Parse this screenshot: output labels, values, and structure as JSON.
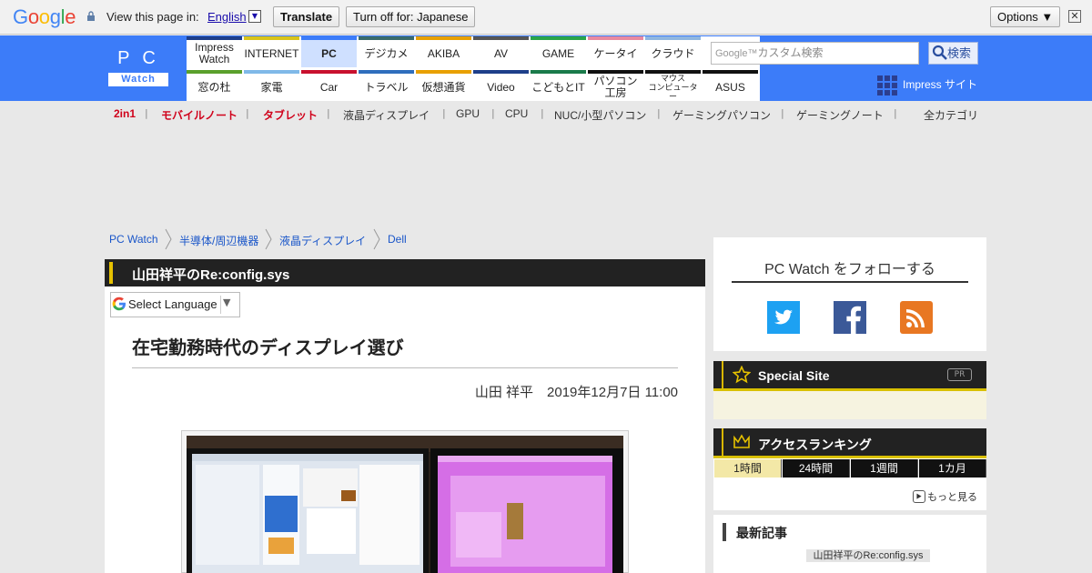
{
  "translate_bar": {
    "logo": "Google",
    "view_text": "View this page in:",
    "language": "English",
    "translate_label": "Translate",
    "turn_off_label": "Turn off for: Japanese",
    "options_label": "Options ▼",
    "close_label": "✕"
  },
  "header": {
    "logo_top": "PC",
    "logo_bottom": "Watch",
    "nav_row1": [
      {
        "label": "Impress\nWatch",
        "color": "#1e3f8a"
      },
      {
        "label": "INTERNET",
        "color": "#d9c41a"
      },
      {
        "label": "PC",
        "color": "#3c7cf9"
      },
      {
        "label": "デジカメ",
        "color": "#3a6b6b"
      },
      {
        "label": "AKIBA",
        "color": "#e8a000"
      },
      {
        "label": "AV",
        "color": "#555555"
      },
      {
        "label": "GAME",
        "color": "#2aa54a"
      },
      {
        "label": "ケータイ",
        "color": "#e88aa0"
      },
      {
        "label": "クラウド",
        "color": "#8fb6e0"
      }
    ],
    "nav_row2": [
      {
        "label": "窓の杜",
        "color": "#5aa02c"
      },
      {
        "label": "家電",
        "color": "#7fb9e8"
      },
      {
        "label": "Car",
        "color": "#c8102e"
      },
      {
        "label": "トラベル",
        "color": "#2f6ebd"
      },
      {
        "label": "仮想通貨",
        "color": "#e8a000"
      },
      {
        "label": "Video",
        "color": "#1e3f8a"
      },
      {
        "label": "こどもとIT",
        "color": "#1a7a4a"
      },
      {
        "label": "パソコン\n工房",
        "color": "#111111"
      },
      {
        "label": "マウス\nコンピューター",
        "color": "#111111"
      },
      {
        "label": "ASUS",
        "color": "#111111"
      }
    ],
    "search_brand": "Google™",
    "search_placeholder": "カスタム検索",
    "search_button": "検索",
    "impress_site": "Impress サイト"
  },
  "subnav": [
    {
      "label": "2in1",
      "red": true
    },
    {
      "label": "モバイルノート",
      "red": true
    },
    {
      "label": "タブレット",
      "red": true
    },
    {
      "label": "液晶ディスプレイ",
      "red": false
    },
    {
      "label": "GPU",
      "red": false
    },
    {
      "label": "CPU",
      "red": false
    },
    {
      "label": "NUC/小型パソコン",
      "red": false
    },
    {
      "label": "ゲーミングパソコン",
      "red": false
    },
    {
      "label": "ゲーミングノート",
      "red": false
    },
    {
      "label": "全カテゴリ",
      "red": false
    }
  ],
  "breadcrumb": [
    "PC Watch",
    "半導体/周辺機器",
    "液晶ディスプレイ",
    "Dell"
  ],
  "article": {
    "series": "山田祥平のRe:config.sys",
    "select_language": "Select Language",
    "title": "在宅勤務時代のディスプレイ選び",
    "byline": "山田 祥平　2019年12月7日 11:00"
  },
  "sidebar": {
    "follow_title": "PC Watch をフォローする",
    "special_site": "Special Site",
    "pr": "PR",
    "ranking_title": "アクセスランキング",
    "tabs": [
      "1時間",
      "24時間",
      "1週間",
      "1カ月"
    ],
    "more": "もっと見る",
    "latest_title": "最新記事",
    "latest_chip": "山田祥平のRe:config.sys"
  },
  "colors": {
    "brand_blue": "#3c7cf9",
    "accent_yellow": "#d9c000",
    "twitter": "#1da1f2",
    "facebook": "#3b5998",
    "rss": "#e87722"
  }
}
